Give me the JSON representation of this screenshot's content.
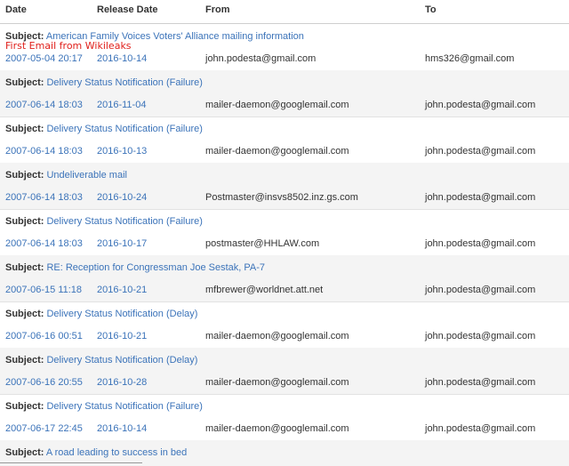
{
  "columns": {
    "date": "Date",
    "release": "Release Date",
    "from": "From",
    "to": "To"
  },
  "subject_label": "Subject:",
  "annotation": "First Email from Wikileaks",
  "emails": [
    {
      "subject": "American Family Voices Voters' Alliance mailing information",
      "date": "2007-05-04 20:17",
      "release": "2016-10-14",
      "from": "john.podesta@gmail.com",
      "to": "hms326@gmail.com"
    },
    {
      "subject": "Delivery Status Notification (Failure)",
      "date": "2007-06-14 18:03",
      "release": "2016-11-04",
      "from": "mailer-daemon@googlemail.com",
      "to": "john.podesta@gmail.com"
    },
    {
      "subject": "Delivery Status Notification (Failure)",
      "date": "2007-06-14 18:03",
      "release": "2016-10-13",
      "from": "mailer-daemon@googlemail.com",
      "to": "john.podesta@gmail.com"
    },
    {
      "subject": "Undeliverable mail",
      "date": "2007-06-14 18:03",
      "release": "2016-10-24",
      "from": "Postmaster@insvs8502.inz.gs.com",
      "to": "john.podesta@gmail.com"
    },
    {
      "subject": "Delivery Status Notification (Failure)",
      "date": "2007-06-14 18:03",
      "release": "2016-10-17",
      "from": "postmaster@HHLAW.com",
      "to": "john.podesta@gmail.com"
    },
    {
      "subject": "RE: Reception for Congressman Joe Sestak, PA-7",
      "date": "2007-06-15 11:18",
      "release": "2016-10-21",
      "from": "mfbrewer@worldnet.att.net",
      "to": "john.podesta@gmail.com"
    },
    {
      "subject": "Delivery Status Notification (Delay)",
      "date": "2007-06-16 00:51",
      "release": "2016-10-21",
      "from": "mailer-daemon@googlemail.com",
      "to": "john.podesta@gmail.com"
    },
    {
      "subject": "Delivery Status Notification (Delay)",
      "date": "2007-06-16 20:55",
      "release": "2016-10-28",
      "from": "mailer-daemon@googlemail.com",
      "to": "john.podesta@gmail.com"
    },
    {
      "subject": "Delivery Status Notification (Failure)",
      "date": "2007-06-17 22:45",
      "release": "2016-10-14",
      "from": "mailer-daemon@googlemail.com",
      "to": "john.podesta@gmail.com"
    },
    {
      "subject": "A road leading to success in bed"
    }
  ]
}
